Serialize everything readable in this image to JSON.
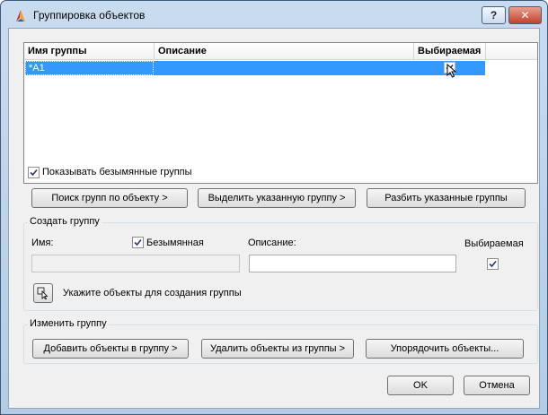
{
  "window": {
    "title": "Группировка объектов",
    "help_label": "?",
    "close_label": "✕"
  },
  "list": {
    "columns": [
      "Имя группы",
      "Описание",
      "Выбираемая"
    ],
    "rows": [
      {
        "name": "*A1",
        "description": "",
        "selectable": true
      }
    ]
  },
  "show_unnamed": {
    "label": "Показывать безымянные группы",
    "checked": true
  },
  "actions": {
    "find": "Поиск групп по объекту >",
    "highlight": "Выделить указанную группу >",
    "explode": "Разбить указанные группы"
  },
  "create_group": {
    "title": "Создать группу",
    "name_label": "Имя:",
    "unnamed_label": "Безымянная",
    "unnamed_checked": true,
    "desc_label": "Описание:",
    "selectable_label": "Выбираемая",
    "selectable_checked": true,
    "name_value": "",
    "desc_value": "",
    "select_objects_label": "Укажите объекты для создания группы"
  },
  "change_group": {
    "title": "Изменить группу",
    "add": "Добавить объекты в группу >",
    "remove": "Удалить объекты из группы >",
    "reorder": "Упорядочить объекты..."
  },
  "footer": {
    "ok": "OK",
    "cancel": "Отмена"
  },
  "colors": {
    "selection": "#3399ff",
    "title_bg": "#c9dcef",
    "close_btn": "#c2412a"
  }
}
